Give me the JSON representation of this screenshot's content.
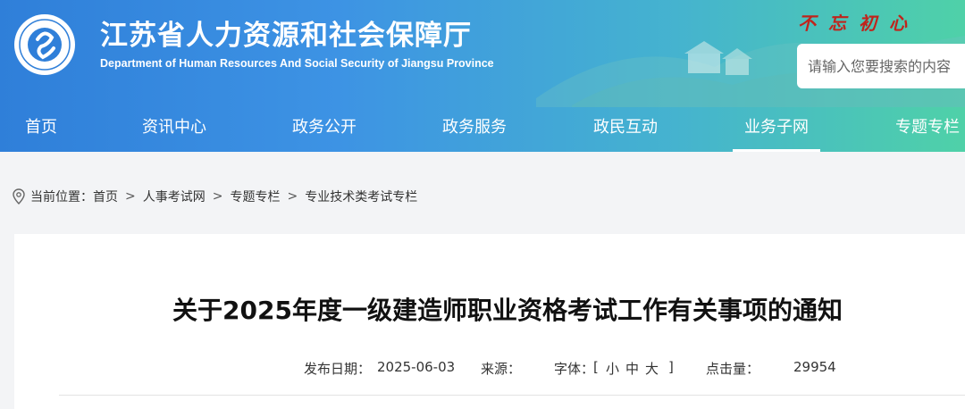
{
  "header": {
    "site_title": "江苏省人力资源和社会保障厅",
    "site_subtitle": "Department of Human Resources And Social Security of Jiangsu Province",
    "motto": "不忘初心",
    "search_placeholder": "请输入您要搜索的内容",
    "logo_icon": "jiangsu-hrss-emblem"
  },
  "nav": {
    "items": [
      {
        "label": "首页"
      },
      {
        "label": "资讯中心"
      },
      {
        "label": "政务公开"
      },
      {
        "label": "政务服务"
      },
      {
        "label": "政民互动"
      },
      {
        "label": "业务子网",
        "active": true
      },
      {
        "label": "专题专栏"
      }
    ]
  },
  "breadcrumb": {
    "prefix": "当前位置：",
    "items": [
      "首页",
      "人事考试网",
      "专题专栏",
      "专业技术类考试专栏"
    ],
    "separator": ">"
  },
  "article": {
    "title": "关于2025年度一级建造师职业资格考试工作有关事项的通知",
    "date_label": "发布日期：",
    "date": "2025-06-03",
    "source_label": "来源：",
    "font_label": "字体：",
    "font_sizes": [
      "[",
      "小",
      "中",
      "大",
      "]"
    ],
    "clicks_label": "点击量：",
    "clicks": "29954"
  },
  "colors": {
    "header_blue": "#3a8fe0",
    "header_green": "#4ccda4",
    "motto_red": "#c0241c"
  }
}
